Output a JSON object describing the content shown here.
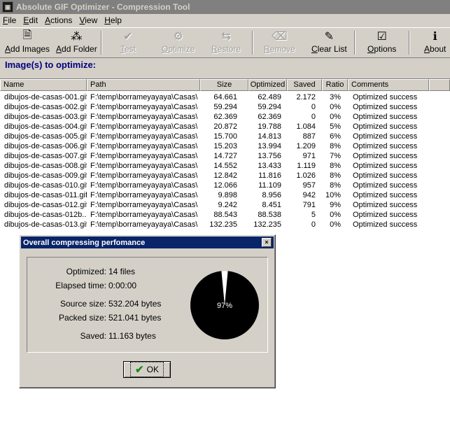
{
  "window": {
    "title": "Absolute GIF Optimizer - Compression Tool"
  },
  "menu": [
    "File",
    "Edit",
    "Actions",
    "View",
    "Help"
  ],
  "toolbar": [
    {
      "label": "Add Images",
      "icon": "add-images-icon",
      "enabled": true
    },
    {
      "label": "Add Folder",
      "icon": "add-folder-icon",
      "enabled": true
    },
    {
      "label": "Test",
      "icon": "test-icon",
      "enabled": false
    },
    {
      "label": "Optimize",
      "icon": "optimize-icon",
      "enabled": false
    },
    {
      "label": "Restore",
      "icon": "restore-icon",
      "enabled": false
    },
    {
      "label": "Remove",
      "icon": "remove-icon",
      "enabled": false
    },
    {
      "label": "Clear List",
      "icon": "clear-list-icon",
      "enabled": true
    },
    {
      "label": "Options",
      "icon": "options-icon",
      "enabled": true
    },
    {
      "label": "About",
      "icon": "about-icon",
      "enabled": true
    }
  ],
  "section_title": "Image(s) to optimize:",
  "columns": [
    "Name",
    "Path",
    "Size",
    "Optimized",
    "Saved",
    "Ratio",
    "Comments"
  ],
  "rows": [
    [
      "dibujos-de-casas-001.gif",
      "F:\\temp\\borrameyayaya\\Casas\\",
      "64.661",
      "62.489",
      "2.172",
      "3%",
      "Optimized success"
    ],
    [
      "dibujos-de-casas-002.gif",
      "F:\\temp\\borrameyayaya\\Casas\\",
      "59.294",
      "59.294",
      "0",
      "0%",
      "Optimized success"
    ],
    [
      "dibujos-de-casas-003.gif",
      "F:\\temp\\borrameyayaya\\Casas\\",
      "62.369",
      "62.369",
      "0",
      "0%",
      "Optimized success"
    ],
    [
      "dibujos-de-casas-004.gif",
      "F:\\temp\\borrameyayaya\\Casas\\",
      "20.872",
      "19.788",
      "1.084",
      "5%",
      "Optimized success"
    ],
    [
      "dibujos-de-casas-005.gif",
      "F:\\temp\\borrameyayaya\\Casas\\",
      "15.700",
      "14.813",
      "887",
      "6%",
      "Optimized success"
    ],
    [
      "dibujos-de-casas-006.gif",
      "F:\\temp\\borrameyayaya\\Casas\\",
      "15.203",
      "13.994",
      "1.209",
      "8%",
      "Optimized success"
    ],
    [
      "dibujos-de-casas-007.gif",
      "F:\\temp\\borrameyayaya\\Casas\\",
      "14.727",
      "13.756",
      "971",
      "7%",
      "Optimized success"
    ],
    [
      "dibujos-de-casas-008.gif",
      "F:\\temp\\borrameyayaya\\Casas\\",
      "14.552",
      "13.433",
      "1.119",
      "8%",
      "Optimized success"
    ],
    [
      "dibujos-de-casas-009.gif",
      "F:\\temp\\borrameyayaya\\Casas\\",
      "12.842",
      "11.816",
      "1.026",
      "8%",
      "Optimized success"
    ],
    [
      "dibujos-de-casas-010.gif",
      "F:\\temp\\borrameyayaya\\Casas\\",
      "12.066",
      "11.109",
      "957",
      "8%",
      "Optimized success"
    ],
    [
      "dibujos-de-casas-011.gif",
      "F:\\temp\\borrameyayaya\\Casas\\",
      "9.898",
      "8.956",
      "942",
      "10%",
      "Optimized success"
    ],
    [
      "dibujos-de-casas-012.gif",
      "F:\\temp\\borrameyayaya\\Casas\\",
      "9.242",
      "8.451",
      "791",
      "9%",
      "Optimized success"
    ],
    [
      "dibujos-de-casas-012b...",
      "F:\\temp\\borrameyayaya\\Casas\\",
      "88.543",
      "88.538",
      "5",
      "0%",
      "Optimized success"
    ],
    [
      "dibujos-de-casas-013.gif",
      "F:\\temp\\borrameyayaya\\Casas\\",
      "132.235",
      "132.235",
      "0",
      "0%",
      "Optimized success"
    ]
  ],
  "dialog": {
    "title": "Overall compressing perfomance",
    "optimized_label": "Optimized:",
    "optimized_value": "14 files",
    "elapsed_label": "Elapsed time:",
    "elapsed_value": "0:00:00",
    "source_label": "Source size:",
    "source_value": "532.204 bytes",
    "packed_label": "Packed size:",
    "packed_value": "521.041 bytes",
    "saved_label": "Saved:",
    "saved_value": "11.163 bytes",
    "pie_label": "97%",
    "pie_fraction": 0.97,
    "ok_label": "OK"
  },
  "colors": {
    "title_inactive": "#808080",
    "dialog_title": "#0a246a",
    "section_title": "#000080"
  }
}
